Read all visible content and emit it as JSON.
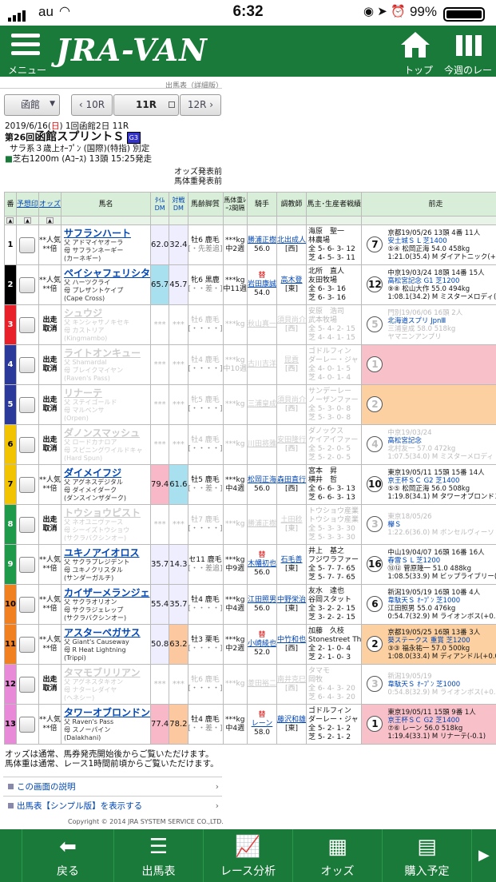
{
  "status": {
    "carrier": "au",
    "time": "6:32",
    "battery": "99%"
  },
  "header": {
    "menu_label": "メニュー",
    "logo": "JRA-VAN",
    "top_label": "トップ",
    "week_label": "今週のレース"
  },
  "subtitle": "出馬表（詳細版）",
  "racebar": {
    "venue": "函館",
    "prev": "10R",
    "current": "11R",
    "next": "12R"
  },
  "race": {
    "date_prefix": "2019/6/16(",
    "date_day": "日",
    "date_suffix": ") 1回函館2日 11R",
    "title_no": "第26回",
    "title": "函館スプリントＳ",
    "grade": "G3",
    "cond": "サラ系３歳上ｵｰﾌﾟﾝ (国際)(特指) 別定",
    "course": "芝右1200m (Aｺｰｽ) 13頭 15:25発走"
  },
  "oddsnote": [
    "オッズ発表前",
    "馬体重発表前"
  ],
  "headers": {
    "ban": "番",
    "yoso": "予想印",
    "odds": "オッズ",
    "horse": "馬名",
    "time_dm": "ﾀｲﾑDM",
    "taisen_dm": "対戦DM",
    "age": "馬齢脚質",
    "weight": "馬体重ﾚｰｽ間隔",
    "jockey": "騎手",
    "trainer": "調教師",
    "owner": "馬主･生産者戦績",
    "prev": "前走"
  },
  "horses": [
    {
      "no": "1",
      "color": "#ffffff",
      "fc": "#000",
      "odds1": "**人気",
      "odds2": "**倍",
      "name": "サフランハート",
      "sire": "父 アドマイヤオーラ",
      "dam": "母 サフランネーギー",
      "bms": "(カーネギー)",
      "tdm": "62.0",
      "vdm": "32.4",
      "age": "牡6 鹿毛",
      "style": "[・先差追]",
      "wt": "***kg",
      "int": "中2週",
      "jmark": "",
      "jockey": "勝浦正樹",
      "jw": "56.0",
      "trainer": "北出成人",
      "tloc": "[西]",
      "owner": "海原　聖一",
      "breeder": "林農場",
      "rec1": "全 5- 6- 3- 12",
      "rec2": "芝 4- 5- 3- 11",
      "pos": "7",
      "p1": "京都19/05/26 13頭 4番 11人",
      "p2": "安土城Ｓ L 芝1400",
      "p3": "⑤④ 松岡正海 54.0 458kg",
      "p4": "1:21.0(35.4) M ダイアトニック(+0.4)",
      "pbg": "#fff",
      "dis": false
    },
    {
      "no": "2",
      "color": "#000000",
      "fc": "#fff",
      "odds1": "**人気",
      "odds2": "**倍",
      "name": "ペイシャフェリシタ",
      "sire": "父 ハーツクライ",
      "dam": "母 プレザントケイプ",
      "bms": "(Cape Cross)",
      "tdm": "65.7",
      "vdm": "45.7",
      "age": "牝6 黒鹿",
      "style": "[・・差・]",
      "wt": "***kg",
      "int": "中11週",
      "jmark": "替",
      "jockey": "岩田康誠",
      "jw": "54.0",
      "trainer": "高木登",
      "tloc": "[東]",
      "owner": "北所　直人",
      "breeder": "友田牧場",
      "rec1": "全 6- 3- 16",
      "rec2": "芝 6- 3- 16",
      "pos": "12",
      "p1": "中京19/03/24 18頭 14番 15人",
      "p2": "高松宮記念 G1 芝1200",
      "p3": "⑨⑧ 松山大作 55.0 494kg",
      "p4": "1:08.1(34.2) M ミスターメロディ(+",
      "pbg": "#fff",
      "dis": false
    },
    {
      "no": "3",
      "color": "#e8202a",
      "fc": "#fff",
      "odds1": "出走",
      "odds2": "取消",
      "name": "シュウジ",
      "sire": "父 キンシャサノキセキ",
      "dam": "母 カストリア",
      "bms": "(Kingmambo)",
      "tdm": "***",
      "vdm": "***",
      "age": "牡6 鹿毛",
      "style": "[・・・・]",
      "wt": "***kg",
      "int": "",
      "jmark": "",
      "jockey": "秋山真一",
      "jw": "",
      "trainer": "須貝尚介",
      "tloc": "[西]",
      "owner": "安原　浩司",
      "breeder": "武本牧場",
      "rec1": "全 5- 4- 2- 15",
      "rec2": "芝 4- 4- 1- 15",
      "pos": "5",
      "p1": "門別19/06/06 16頭 2人",
      "p2": "北海道スプリ JpnⅢ",
      "p3": "三浦皇成 58.0 518kg",
      "p4": "ヤマニンアンプリ",
      "pbg": "#fff",
      "dis": true
    },
    {
      "no": "4",
      "color": "#2b3a9a",
      "fc": "#fff",
      "odds1": "出走",
      "odds2": "取消",
      "name": "ライトオンキュー",
      "sire": "父 Shamardal",
      "dam": "母 ブレイクマイヤン",
      "bms": "(Raven's Pass)",
      "tdm": "***",
      "vdm": "***",
      "age": "牡4 鹿毛",
      "style": "[・・・・]",
      "wt": "***kg",
      "int": "中10週",
      "jmark": "",
      "jockey": "古川吉洋",
      "jw": "",
      "trainer": "昆貢",
      "tloc": "[西]",
      "owner": "ゴドルフィン",
      "breeder": "ダーレー・ジャ",
      "rec1": "全 4- 0- 1- 5",
      "rec2": "芝 4- 0- 1- 4",
      "pos": "1",
      "p1": "",
      "p2": "",
      "p3": "",
      "p4": "",
      "pbg": "#f8c0c8",
      "dis": true
    },
    {
      "no": "5",
      "color": "#2b3a9a",
      "fc": "#fff",
      "odds1": "出走",
      "odds2": "取消",
      "name": "リナーテ",
      "sire": "父 ステイゴールド",
      "dam": "母 マルペンサ",
      "bms": "(Orpen)",
      "tdm": "***",
      "vdm": "***",
      "age": "牝5 鹿毛",
      "style": "[・・・・]",
      "wt": "***kg",
      "int": "",
      "jmark": "",
      "jockey": "三浦皇成",
      "jw": "",
      "trainer": "須貝尚介",
      "tloc": "[西]",
      "owner": "サンデーレー",
      "breeder": "ノーザンファー",
      "rec1": "全 5- 3- 0- 8",
      "rec2": "芝 5- 3- 0- 8",
      "pos": "2",
      "p1": "",
      "p2": "",
      "p3": "",
      "p4": "",
      "pbg": "#fcd0a0",
      "dis": true
    },
    {
      "no": "6",
      "color": "#f2c300",
      "fc": "#000",
      "odds1": "出走",
      "odds2": "取消",
      "name": "ダノンスマッシュ",
      "sire": "父 ロードカナロア",
      "dam": "母 スピニングワイルドキャ",
      "bms": "(Hard Spun)",
      "tdm": "***",
      "vdm": "***",
      "age": "牡4 鹿毛",
      "style": "[・・・・]",
      "wt": "***kg",
      "int": "",
      "jmark": "",
      "jockey": "川田将雅",
      "jw": "",
      "trainer": "安田隆行",
      "tloc": "[西]",
      "owner": "ダノックス",
      "breeder": "ケイアイファー",
      "rec1": "全 5- 2- 0- 5",
      "rec2": "芝 5- 2- 0- 5",
      "pos": "4",
      "p1": "中京19/03/24",
      "p2": "高松宮記念",
      "p3": "北村友一 57.0 472kg",
      "p4": "1:07.5(34.0) M ミスターメロディ",
      "pbg": "#fff",
      "dis": true
    },
    {
      "no": "7",
      "color": "#f2c300",
      "fc": "#000",
      "odds1": "**人気",
      "odds2": "**倍",
      "name": "ダイメイフジ",
      "sire": "父 アグネスデジタル",
      "dam": "母 ダイメイダーク",
      "bms": "(ダンスインザダーク)",
      "tdm": "79.4",
      "vdm": "61.6",
      "age": "牡5 鹿毛",
      "style": "[・・差・]",
      "wt": "***kg",
      "int": "中4週",
      "jmark": "",
      "jockey": "松岡正海",
      "jw": "56.0",
      "trainer": "森田直行",
      "tloc": "[西]",
      "owner": "宮本　昇",
      "breeder": "横井　哲",
      "rec1": "全 6- 6- 3- 13",
      "rec2": "芝 6- 6- 3- 13",
      "pos": "10",
      "p1": "東京19/05/11 15頭 15番 14人",
      "p2": "京王杯ＳＣ G2 芝1400",
      "p3": "⑤⑤ 松岡正海 56.0 508kg",
      "p4": "1:19.8(34.1) M タワーオブロンドン",
      "pbg": "#fff",
      "dis": false
    },
    {
      "no": "8",
      "color": "#1f9a4a",
      "fc": "#fff",
      "odds1": "出走",
      "odds2": "取消",
      "name": "トウショウピスト",
      "sire": "父 ネオユニヴァース",
      "dam": "母 シーイズトウショウ",
      "bms": "(サクラバクシンオー)",
      "tdm": "***",
      "vdm": "***",
      "age": "牡7 鹿毛",
      "style": "[・・・・]",
      "wt": "***kg",
      "int": "",
      "jmark": "",
      "jockey": "勝浦正樹",
      "jw": "",
      "trainer": "土田稔",
      "tloc": "[東]",
      "owner": "トウショウ産業",
      "breeder": "トウショウ産業",
      "rec1": "全 5- 3- 3- 30",
      "rec2": "芝 5- 3- 3- 30",
      "pos": "3",
      "p1": "東京18/05/26",
      "p2": "欅Ｓ",
      "p3": "",
      "p4": "1:22.6(36.0) M ボンセルヴィーソ",
      "pbg": "#fff",
      "dis": true
    },
    {
      "no": "9",
      "color": "#1f9a4a",
      "fc": "#fff",
      "odds1": "**人気",
      "odds2": "**倍",
      "name": "ユキノアイオロス",
      "sire": "父 サクラプレジデント",
      "dam": "母 ユキノクリスタル",
      "bms": "(サンダーガルチ)",
      "tdm": "35.7",
      "vdm": "14.3",
      "age": "セ11 鹿毛",
      "style": "[・・差追]",
      "wt": "***kg",
      "int": "中9週",
      "jmark": "替",
      "jockey": "木幡初也",
      "jw": "56.0",
      "trainer": "石毛善",
      "tloc": "[東]",
      "owner": "井上　基之",
      "breeder": "フジワラファー",
      "rec1": "全 5- 7- 7- 65",
      "rec2": "芝 5- 7- 7- 65",
      "pos": "16",
      "p1": "中山19/04/07 16頭 16番 16人",
      "p2": "春雷Ｓ L 芝1200",
      "p3": "⑬⑫ 菅原隆一 51.0 488kg",
      "p4": "1:08.5(33.9) M ビップライブリー(+",
      "pbg": "#fff",
      "dis": false
    },
    {
      "no": "10",
      "color": "#f08020",
      "fc": "#000",
      "odds1": "**人気",
      "odds2": "**倍",
      "name": "カイザーメランジェ",
      "sire": "父 サクラオリオン",
      "dam": "母 サクラジェレップ",
      "bms": "(サクラバクシンオー)",
      "tdm": "55.4",
      "vdm": "35.7",
      "age": "牡4 鹿毛",
      "style": "[・・・・]",
      "wt": "***kg",
      "int": "中4週",
      "jmark": "",
      "jockey": "江田照男",
      "jw": "56.0",
      "trainer": "中野栄治",
      "tloc": "[東]",
      "owner": "友水　達也",
      "breeder": "谷岡スタット",
      "rec1": "全 3- 2- 2- 15",
      "rec2": "芝 3- 2- 2- 15",
      "pos": "6",
      "p1": "新潟19/05/19 16頭 10番 4人",
      "p2": "韋駄天Ｓ ｵｰﾌﾟﾝ 芝1000",
      "p3": "江田照男 55.0 476kg",
      "p4": "0:54.7(32.9) M ライオンボス(+0.8)",
      "pbg": "#fff",
      "dis": false
    },
    {
      "no": "11",
      "color": "#f08020",
      "fc": "#000",
      "odds1": "**人気",
      "odds2": "**倍",
      "name": "アスターペガサス",
      "sire": "父 Giant's Causeway",
      "dam": "母 R Heat Lightning",
      "bms": "(Trippi)",
      "tdm": "50.8",
      "vdm": "63.2",
      "age": "牡3 栗毛",
      "style": "[・・・・]",
      "wt": "***kg",
      "int": "中2週",
      "jmark": "替",
      "jockey": "小崎綾也",
      "jw": "52.0",
      "trainer": "中竹和也",
      "tloc": "[西]",
      "owner": "加藤　久枝",
      "breeder": "Stonestreet Th",
      "rec1": "全 2- 1- 0- 4",
      "rec2": "芝 2- 1- 0- 3",
      "pos": "2",
      "p1": "京都19/05/25 16頭 13番 3人",
      "p2": "葵ステークス 重賞 芝1200",
      "p3": "③③ 福永祐一 57.0 500kg",
      "p4": "1:08.0(33.4) M ディアンドル(+0.0)",
      "pbg": "#fcd0a0",
      "dis": false
    },
    {
      "no": "12",
      "color": "#e88ad8",
      "fc": "#000",
      "odds1": "出走",
      "odds2": "取消",
      "name": "タマモブリリアン",
      "sire": "父 アグネスタキオン",
      "dam": "母 ナターレダイヤ",
      "bms": "(ヘネシー)",
      "tdm": "***",
      "vdm": "***",
      "age": "牝6 鹿毛",
      "style": "[・・・・]",
      "wt": "***kg",
      "int": "",
      "jmark": "",
      "jockey": "菱田裕二",
      "jw": "",
      "trainer": "南井克巳",
      "tloc": "[西]",
      "owner": "タマモ",
      "breeder": "岡牧",
      "rec1": "全 6- 4- 3- 20",
      "rec2": "芝 6- 4- 3- 20",
      "pos": "3",
      "p1": "新潟19/05/19",
      "p2": "韋駄天Ｓ ｵｰﾌﾟﾝ 芝1000",
      "p3": "",
      "p4": "0:54.8(32.9) M ライオンボス(+0.8)",
      "pbg": "#fff",
      "dis": true
    },
    {
      "no": "13",
      "color": "#e88ad8",
      "fc": "#000",
      "odds1": "**人気",
      "odds2": "**倍",
      "name": "タワーオブロンドン",
      "sire": "父 Raven's Pass",
      "dam": "母 スノーパイン",
      "bms": "(Dalakhani)",
      "tdm": "77.4",
      "vdm": "78.2",
      "age": "牡4 鹿毛",
      "style": "[・・差・]",
      "wt": "***kg",
      "int": "中4週",
      "jmark": "替",
      "jockey": "レーン",
      "jw": "58.0",
      "trainer": "藤沢和雄",
      "tloc": "[東]",
      "owner": "ゴドルフィン",
      "breeder": "ダーレー・ジャ",
      "rec1": "全 5- 2- 1- 2",
      "rec2": "芝 5- 2- 1- 2",
      "pos": "1",
      "p1": "東京19/05/11 15頭 9番 1人",
      "p2": "京王杯ＳＣ G2 芝1400",
      "p3": "⑦⑥ レーン 56.0 518kg",
      "p4": "1:19.4(33.1) M リナーテ(-0.1)",
      "pbg": "#f8c0c8",
      "dis": false
    }
  ],
  "footnote": [
    "オッズは通常、馬券発売開始後からご覧いただけます。",
    "馬体重は通常、レース1時間前頃からご覧いただけます。"
  ],
  "links": [
    "この画面の説明",
    "出馬表【シンプル版】を表示する"
  ],
  "copyright": "Copyright © 2014 JRA SYSTEM SERVICE CO.,LTD.",
  "tabs": [
    "戻る",
    "出馬表",
    "レース分析",
    "オッズ",
    "購入予定"
  ]
}
